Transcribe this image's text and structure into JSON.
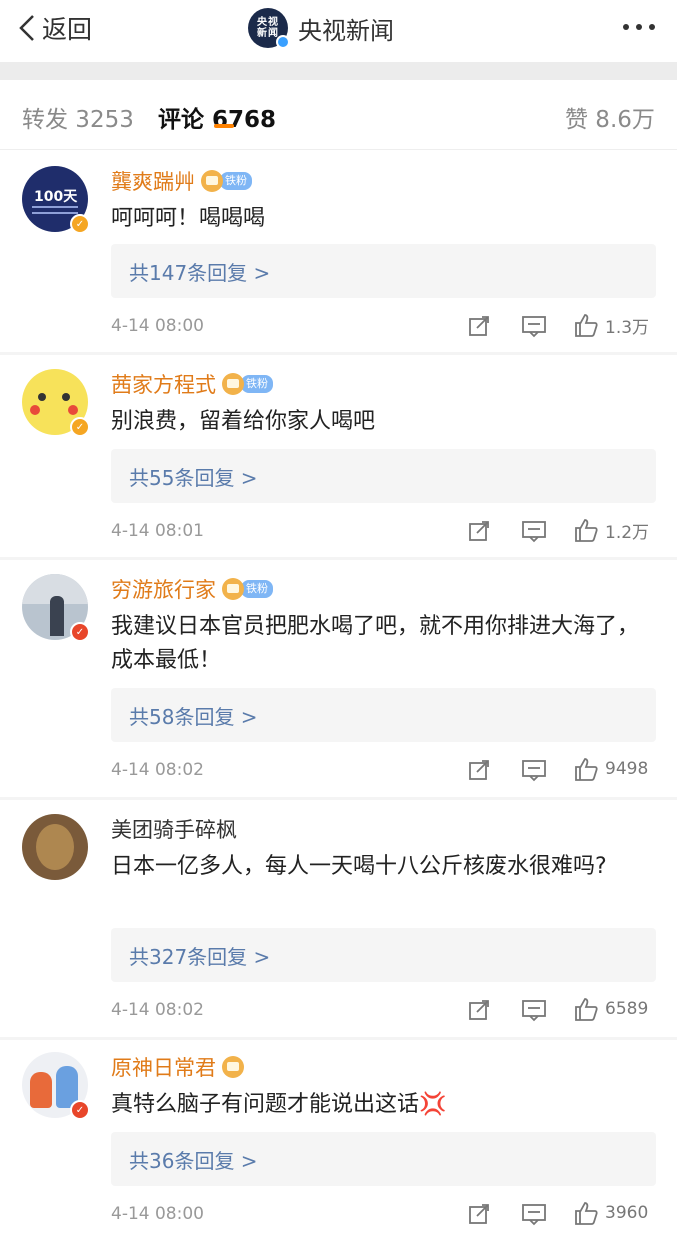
{
  "header": {
    "back_label": "返回",
    "title": "央视新闻",
    "logo_text_line1": "央视",
    "logo_text_line2": "新闻"
  },
  "tabs": {
    "repost": "转发 3253",
    "comments": "评论 6768",
    "likes": "赞 8.6万"
  },
  "comments": [
    {
      "user": "龔爽踹艸",
      "fan_badge": "铁粉",
      "text": "呵呵呵！喝喝喝",
      "replies": "共147条回复 >",
      "time": "4-14 08:00",
      "likes": "1.3万",
      "avatar_text": "100天"
    },
    {
      "user": "茜家方程式",
      "fan_badge": "铁粉",
      "text": "别浪费，留着给你家人喝吧",
      "replies": "共55条回复 >",
      "time": "4-14 08:01",
      "likes": "1.2万"
    },
    {
      "user": "穷游旅行家",
      "fan_badge": "铁粉",
      "text": "我建议日本官员把肥水喝了吧，就不用你排进大海了，成本最低！",
      "replies": "共58条回复 >",
      "time": "4-14 08:02",
      "likes": "9498"
    },
    {
      "user": "美团骑手碎枫",
      "text": "日本一亿多人，每人一天喝十八公斤核废水很难吗?",
      "replies": "共327条回复 >",
      "time": "4-14 08:02",
      "likes": "6589"
    },
    {
      "user": "原神日常君",
      "text": "真特么脑子有问题才能说出这话💢",
      "replies": "共36条回复 >",
      "time": "4-14 08:00",
      "likes": "3960"
    }
  ]
}
